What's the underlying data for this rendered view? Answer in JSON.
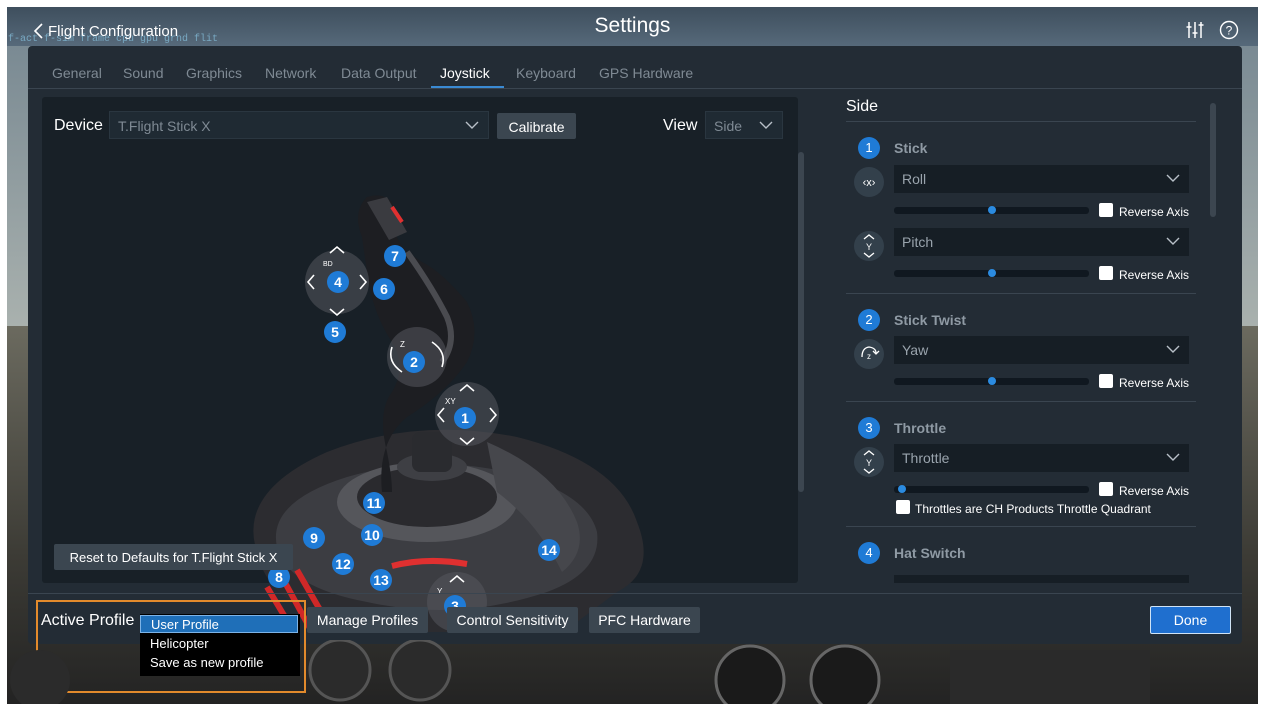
{
  "header": {
    "back_label": "Flight Configuration",
    "title": "Settings",
    "hud_text": "f-act   f-sim   frame   cpu   gpu   grnd   flit"
  },
  "tabs": [
    {
      "label": "General",
      "active": false
    },
    {
      "label": "Sound",
      "active": false
    },
    {
      "label": "Graphics",
      "active": false
    },
    {
      "label": "Network",
      "active": false
    },
    {
      "label": "Data Output",
      "active": false
    },
    {
      "label": "Joystick",
      "active": true
    },
    {
      "label": "Keyboard",
      "active": false
    },
    {
      "label": "GPS Hardware",
      "active": false
    }
  ],
  "left": {
    "device_label": "Device",
    "device_value": "T.Flight Stick X",
    "calibrate_label": "Calibrate",
    "view_label": "View",
    "view_value": "Side",
    "reset_label": "Reset to Defaults for T.Flight Stick X",
    "axis_labels": {
      "bd": "BD",
      "z": "Z",
      "xy": "XY",
      "y": "Y"
    },
    "badges": [
      "1",
      "2",
      "3",
      "4",
      "5",
      "6",
      "7",
      "8",
      "9",
      "10",
      "11",
      "12",
      "13",
      "14"
    ]
  },
  "right": {
    "title": "Side",
    "sections": [
      {
        "num": "1",
        "title": "Stick",
        "axes": [
          {
            "value": "Roll",
            "slider": 0.5,
            "reverse_label": "Reverse Axis",
            "icon": "x-axis-icon"
          },
          {
            "value": "Pitch",
            "slider": 0.5,
            "reverse_label": "Reverse Axis",
            "icon": "y-axis-icon"
          }
        ]
      },
      {
        "num": "2",
        "title": "Stick Twist",
        "axes": [
          {
            "value": "Yaw",
            "slider": 0.5,
            "reverse_label": "Reverse Axis",
            "icon": "z-twist-icon"
          }
        ]
      },
      {
        "num": "3",
        "title": "Throttle",
        "axes": [
          {
            "value": "Throttle",
            "slider": 0.02,
            "reverse_label": "Reverse Axis",
            "icon": "y-axis-icon"
          }
        ],
        "extra_checkbox": "Throttles are CH Products Throttle Quadrant"
      },
      {
        "num": "4",
        "title": "Hat Switch",
        "axes": []
      }
    ]
  },
  "bottom": {
    "active_profile_label": "Active Profile",
    "profile_options": [
      "User Profile",
      "Helicopter",
      "Save as new profile"
    ],
    "selected_profile": "User Profile",
    "manage_label": "Manage Profiles",
    "sensitivity_label": "Control Sensitivity",
    "pfc_label": "PFC Hardware",
    "done_label": "Done"
  },
  "colors": {
    "accent": "#1f7bd6",
    "highlight_border": "#e28a2c"
  }
}
